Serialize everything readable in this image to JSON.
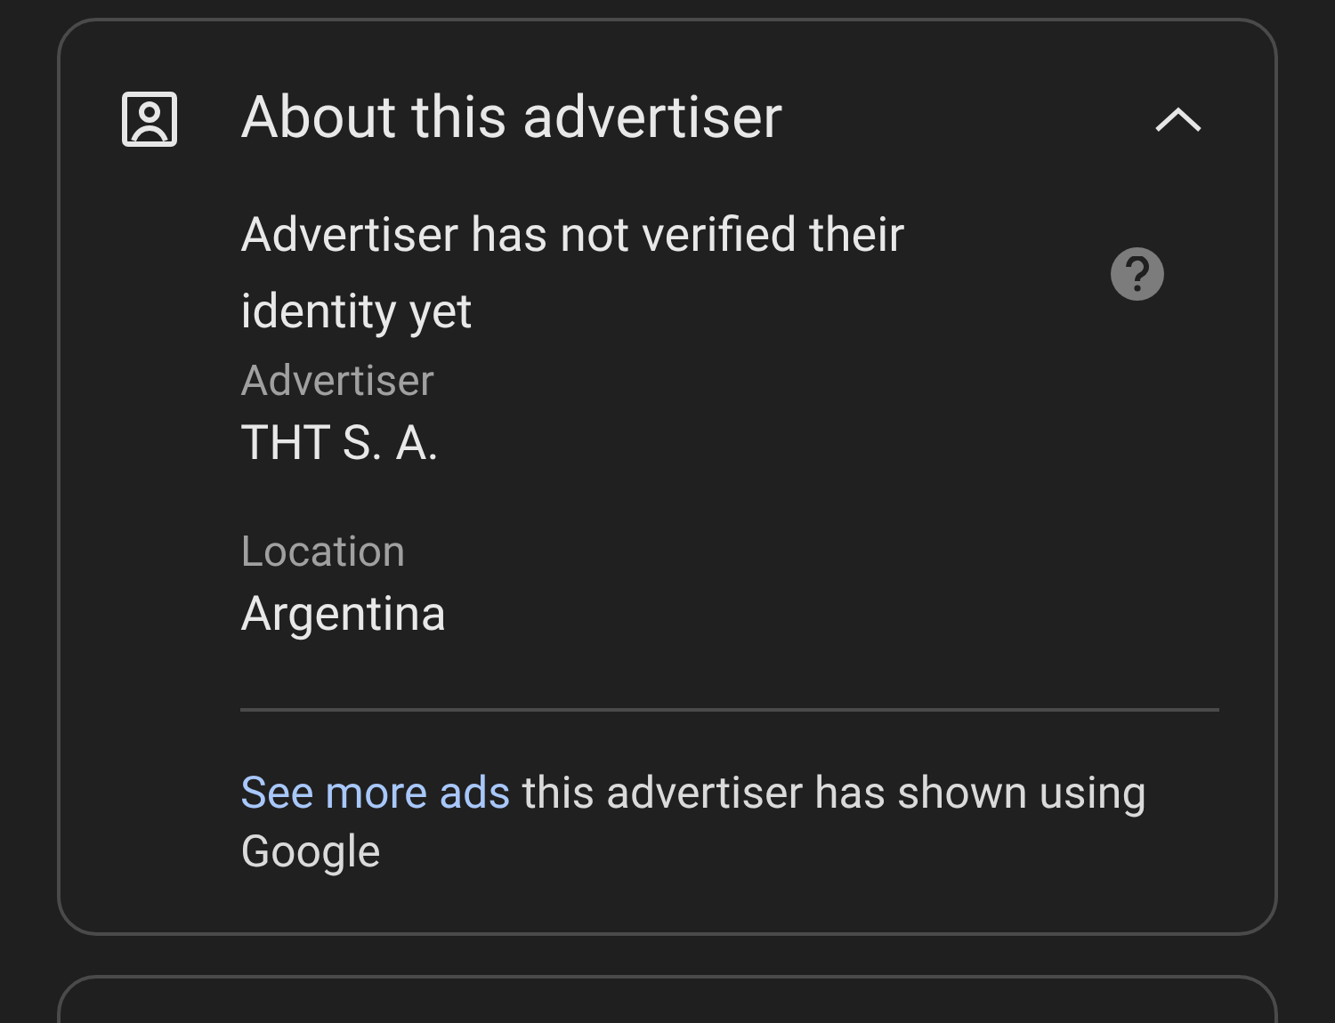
{
  "card": {
    "title": "About this advertiser",
    "expanded": true,
    "verification": "Advertiser has not verified their identity yet",
    "fields": [
      {
        "label": "Advertiser",
        "value": "THT S. A."
      },
      {
        "label": "Location",
        "value": "Argentina"
      }
    ],
    "footer": {
      "link": "See more ads",
      "text": " this advertiser has shown using Google"
    }
  }
}
